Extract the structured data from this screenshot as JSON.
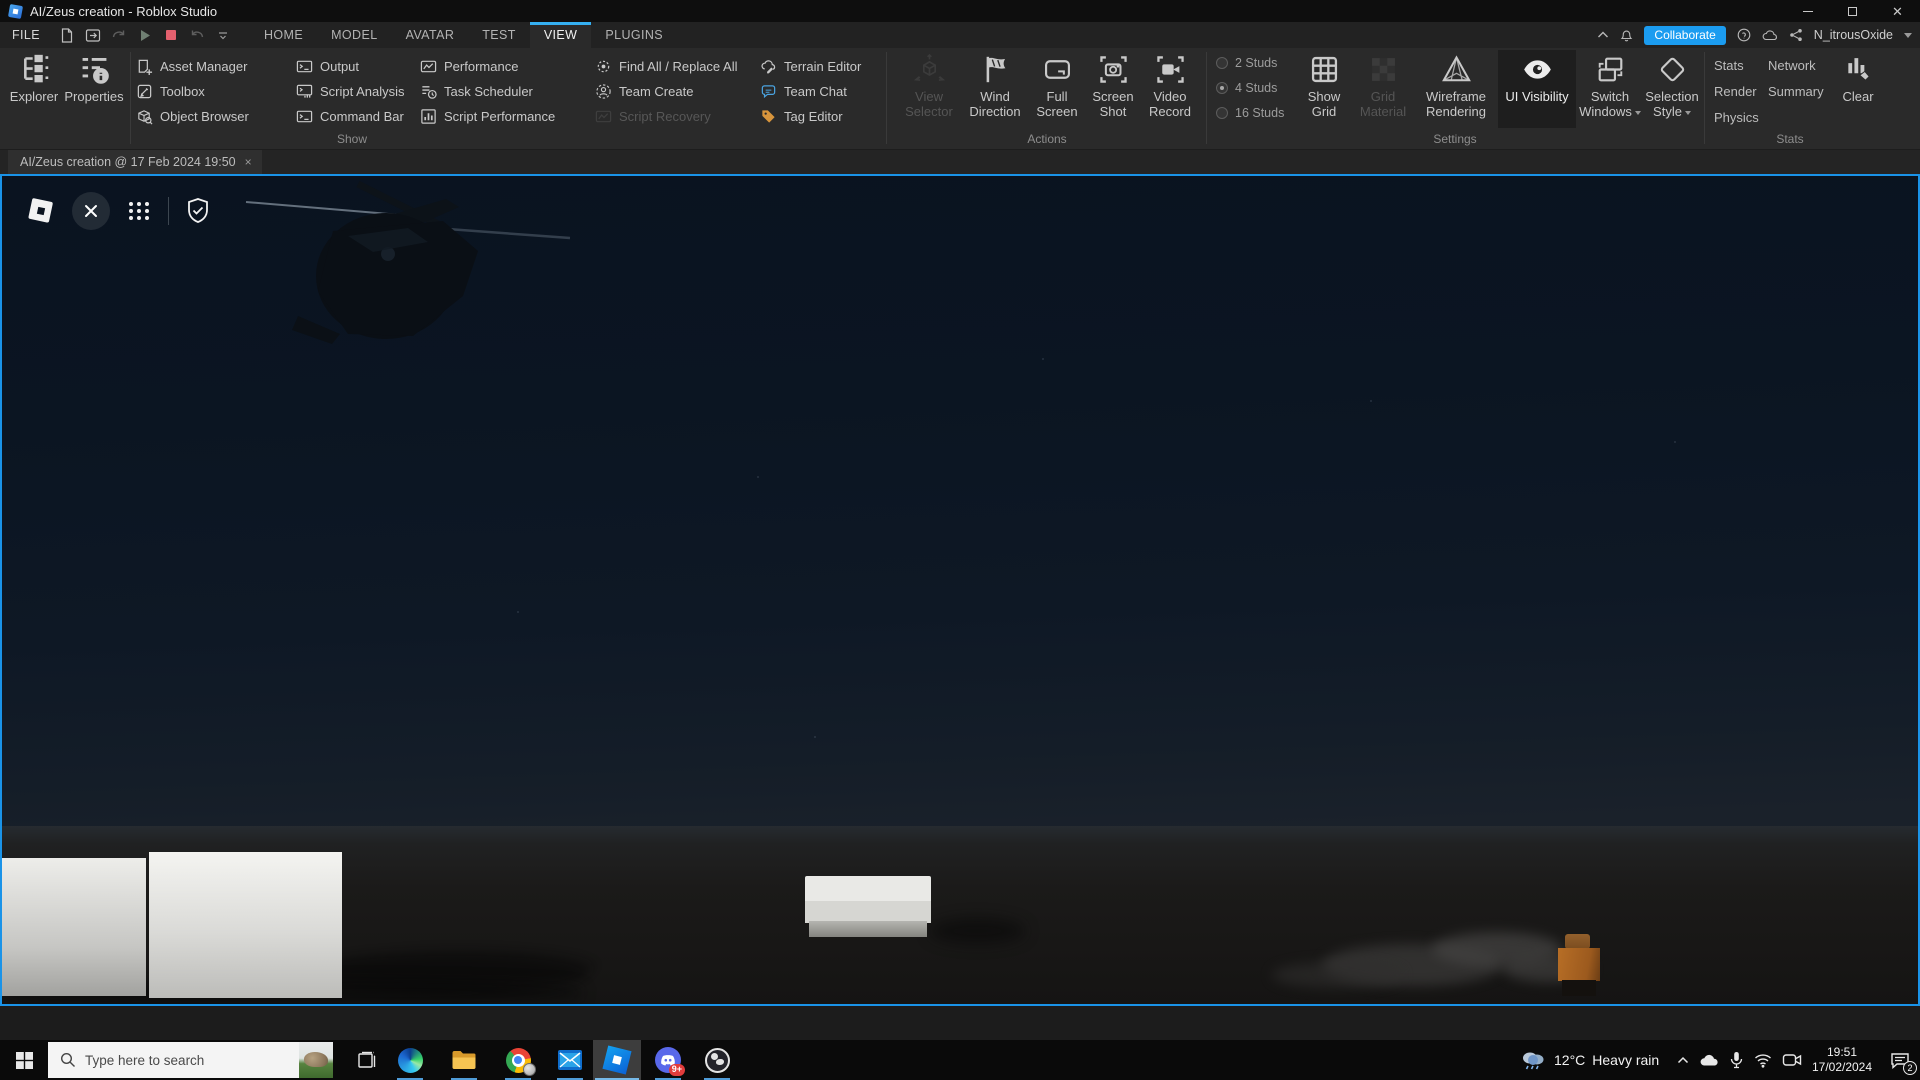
{
  "window": {
    "title": "AI/Zeus creation - Roblox Studio"
  },
  "menu": {
    "file": "FILE",
    "tabs": [
      "HOME",
      "MODEL",
      "AVATAR",
      "TEST",
      "VIEW",
      "PLUGINS"
    ],
    "active": "VIEW",
    "collaborate": "Collaborate",
    "username": "N_itrousOxide"
  },
  "ribbon": {
    "show": {
      "label": "Show",
      "big": [
        {
          "label": "Explorer"
        },
        {
          "label": "Properties"
        }
      ],
      "cols": [
        {
          "items": [
            {
              "label": "Asset Manager"
            },
            {
              "label": "Toolbox"
            },
            {
              "label": "Object Browser"
            }
          ]
        },
        {
          "items": [
            {
              "label": "Output"
            },
            {
              "label": "Script Analysis"
            },
            {
              "label": "Command Bar"
            }
          ]
        },
        {
          "items": [
            {
              "label": "Performance"
            },
            {
              "label": "Task Scheduler"
            },
            {
              "label": "Script Performance"
            }
          ]
        },
        {
          "items": [
            {
              "label": "Find All / Replace All"
            },
            {
              "label": "Team Create"
            },
            {
              "label": "Script Recovery"
            }
          ]
        },
        {
          "items": [
            {
              "label": "Terrain Editor"
            },
            {
              "label": "Team Chat"
            },
            {
              "label": "Tag Editor"
            }
          ]
        }
      ]
    },
    "actions": {
      "label": "Actions",
      "buttons": [
        {
          "label": "View Selector"
        },
        {
          "label": "Wind Direction"
        },
        {
          "label": "Full Screen"
        },
        {
          "label": "Screen Shot"
        },
        {
          "label": "Video Record"
        }
      ]
    },
    "settings": {
      "label": "Settings",
      "studs": [
        {
          "label": "2 Studs"
        },
        {
          "label": "4 Studs"
        },
        {
          "label": "16 Studs"
        }
      ],
      "selected_stud": "4 Studs",
      "buttons": [
        {
          "label": "Show Grid"
        },
        {
          "label": "Grid Material"
        },
        {
          "label": "Wireframe Rendering"
        },
        {
          "label": "UI Visibility"
        },
        {
          "label": "Switch Windows"
        },
        {
          "label": "Selection Style"
        }
      ]
    },
    "stats": {
      "label": "Stats",
      "col1": [
        "Stats",
        "Render",
        "Physics"
      ],
      "col2": [
        "Network",
        "Summary"
      ],
      "clear": "Clear"
    }
  },
  "tabbar": {
    "tab": "AI/Zeus creation @ 17 Feb 2024 19:50",
    "close": "×"
  },
  "taskbar": {
    "search": "Type here to search",
    "discord_badge": "9+",
    "weather_temp": "12°C",
    "weather_cond": "Heavy rain",
    "time": "19:51",
    "date": "17/02/2024",
    "notification_count": "2"
  }
}
